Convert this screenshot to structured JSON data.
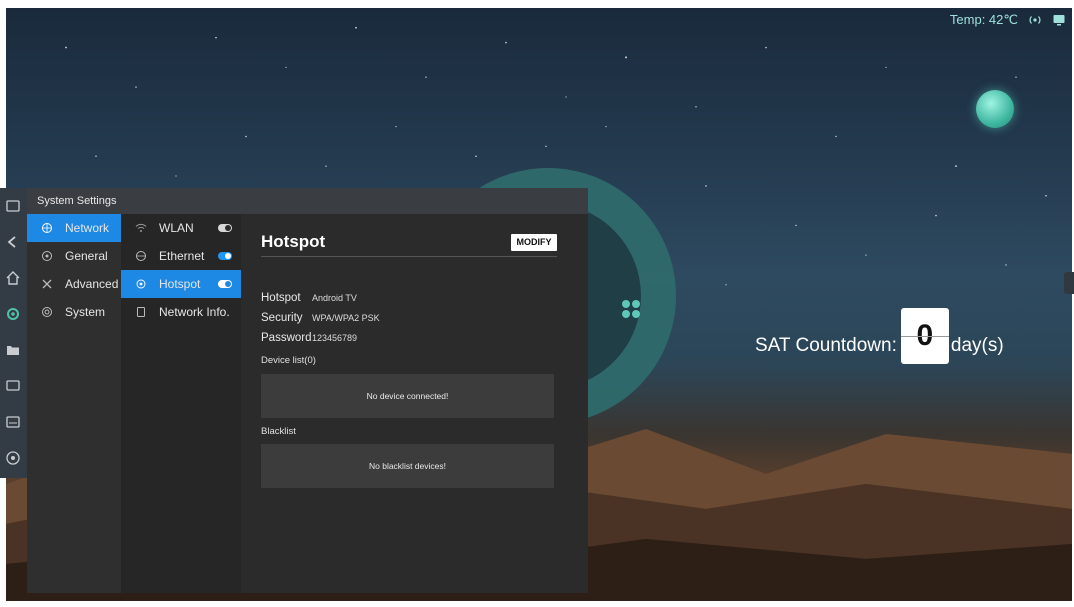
{
  "topbar": {
    "temp": "Temp: 42℃"
  },
  "countdown": {
    "prefix": "SAT Countdown:",
    "value": "0",
    "suffix": "day(s)"
  },
  "window": {
    "title": "System Settings"
  },
  "categories": [
    {
      "label": "Network",
      "icon": "network-icon",
      "active": true
    },
    {
      "label": "General",
      "icon": "general-icon",
      "active": false
    },
    {
      "label": "Advanced",
      "icon": "advanced-icon",
      "active": false
    },
    {
      "label": "System",
      "icon": "system-icon",
      "active": false
    }
  ],
  "network_items": [
    {
      "label": "WLAN",
      "icon": "wifi-icon",
      "toggle": "off",
      "active": false
    },
    {
      "label": "Ethernet",
      "icon": "ethernet-icon",
      "toggle": "on",
      "active": false
    },
    {
      "label": "Hotspot",
      "icon": "hotspot-icon",
      "toggle": "on",
      "active": true
    },
    {
      "label": "Network Info.",
      "icon": "network-info-icon",
      "toggle": null,
      "active": false
    }
  ],
  "hotspot": {
    "title": "Hotspot",
    "modify_label": "MODIFY",
    "fields": [
      {
        "key": "Hotspot",
        "value": "Android TV"
      },
      {
        "key": "Security",
        "value": "WPA/WPA2 PSK"
      },
      {
        "key": "Password",
        "value": "123456789"
      }
    ],
    "device_list_label": "Device list(0)",
    "device_list_empty": "No device connected!",
    "blacklist_label": "Blacklist",
    "blacklist_empty": "No blacklist devices!"
  },
  "colors": {
    "accent": "#1e88e5",
    "teal": "#3fb7a1",
    "panel": "#2b2b2b"
  }
}
